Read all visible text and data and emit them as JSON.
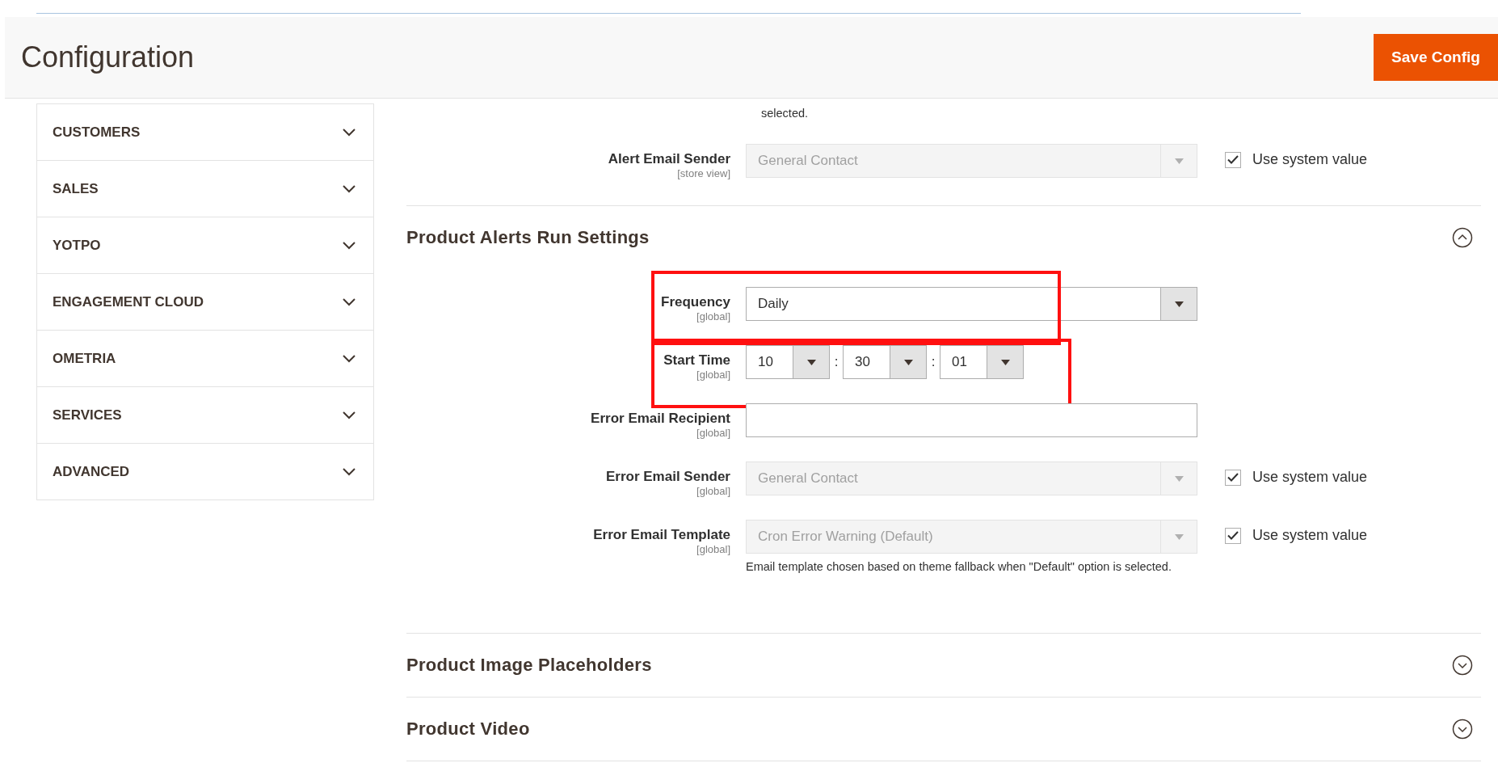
{
  "header": {
    "title": "Configuration",
    "save_button": "Save Config"
  },
  "sidebar": {
    "items": [
      {
        "label": "CUSTOMERS",
        "expanded": false
      },
      {
        "label": "SALES",
        "expanded": false
      },
      {
        "label": "YOTPO",
        "expanded": false
      },
      {
        "label": "ENGAGEMENT CLOUD",
        "expanded": false
      },
      {
        "label": "OMETRIA",
        "expanded": false
      },
      {
        "label": "SERVICES",
        "expanded": false
      },
      {
        "label": "ADVANCED",
        "expanded": false
      }
    ]
  },
  "previous_section": {
    "note": "selected.",
    "fields": [
      {
        "kind": "select",
        "label": "Alert Email Sender",
        "scope": "[store view]",
        "value": "General Contact",
        "disabled": true,
        "highlighted": false,
        "use_system_value": {
          "label": "Use system value",
          "checked": true
        }
      }
    ]
  },
  "sections": [
    {
      "title": "Product Alerts Run Settings",
      "expanded": true,
      "fields": [
        {
          "kind": "select",
          "label": "Frequency",
          "scope": "[global]",
          "value": "Daily",
          "disabled": false,
          "highlighted": true
        },
        {
          "kind": "time",
          "label": "Start Time",
          "scope": "[global]",
          "parts": [
            "10",
            "30",
            "01"
          ],
          "separators": [
            ":",
            ":"
          ],
          "highlighted": true
        },
        {
          "kind": "text",
          "label": "Error Email Recipient",
          "scope": "[global]",
          "highlighted": false
        },
        {
          "kind": "select",
          "label": "Error Email Sender",
          "scope": "[global]",
          "value": "General Contact",
          "disabled": true,
          "highlighted": false,
          "use_system_value": {
            "label": "Use system value",
            "checked": true
          }
        },
        {
          "kind": "select",
          "label": "Error Email Template",
          "scope": "[global]",
          "value": "Cron Error Warning (Default)",
          "disabled": true,
          "highlighted": false,
          "use_system_value": {
            "label": "Use system value",
            "checked": true
          },
          "note": "Email template chosen based on theme fallback when \"Default\" option is selected."
        }
      ]
    },
    {
      "title": "Product Image Placeholders",
      "expanded": false
    },
    {
      "title": "Product Video",
      "expanded": false
    }
  ]
}
